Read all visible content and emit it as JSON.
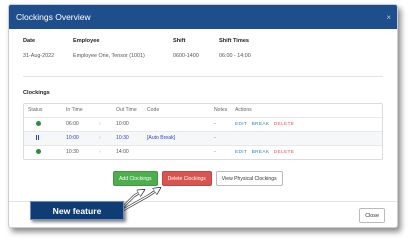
{
  "dialog": {
    "title": "Clockings Overview",
    "close_glyph": "×"
  },
  "summary": {
    "headers": {
      "date": "Date",
      "employee": "Employee",
      "shift": "Shift",
      "shift_times": "Shift Times"
    },
    "values": {
      "date": "31-Aug-2022",
      "employee": "Employee One, Tensor (1001)",
      "shift": "0600-1400",
      "shift_times": "06:00 - 14:00"
    }
  },
  "clockings": {
    "title": "Clockings",
    "columns": {
      "status": "Status",
      "in_time": "In Time",
      "out_time": "Out Time",
      "code": "Code",
      "notes": "Notes",
      "actions": "Actions"
    },
    "arrow_glyph": "›",
    "rows": [
      {
        "status_icon": "check-circle-icon",
        "in": "06:00",
        "out": "10:00",
        "code": "",
        "notes": "-",
        "actions": [
          "EDIT",
          "BREAK",
          "DELETE"
        ]
      },
      {
        "status_icon": "pause-icon",
        "in": "10:00",
        "out": "10:30",
        "code": "[Auto Break]",
        "notes": "-",
        "actions": []
      },
      {
        "status_icon": "check-circle-icon",
        "in": "10:30",
        "out": "14:00",
        "code": "",
        "notes": "-",
        "actions": [
          "EDIT",
          "BREAK",
          "DELETE"
        ]
      }
    ]
  },
  "buttons": {
    "add": "Add Clockings",
    "delete": "Delete Clockings",
    "view": "View Physical Clockings"
  },
  "footer": {
    "close": "Close"
  },
  "callout": {
    "text": "New feature"
  },
  "colors": {
    "header": "#1f4e8c",
    "green": "#4cae4c",
    "red": "#d9534f",
    "callout": "#0f3c75",
    "link": "#2e86c1",
    "danger_link": "#e05a5a",
    "break_text": "#2d3fd6"
  }
}
